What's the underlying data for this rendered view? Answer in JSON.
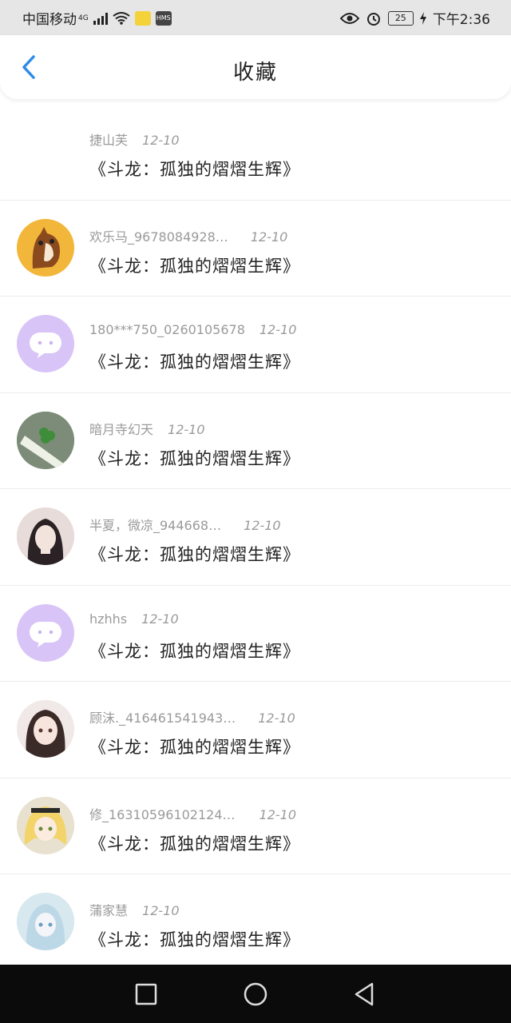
{
  "status_bar": {
    "carrier": "中国移动",
    "network": "4G",
    "battery": "25",
    "time": "下午2:36"
  },
  "header": {
    "title": "收藏"
  },
  "items": [
    {
      "name": "捷山芙",
      "date": "12-10",
      "content": "《斗龙：孤独的熠熠生辉》",
      "avatar": "none"
    },
    {
      "name": "欢乐马_9678084928…",
      "date": "12-10",
      "content": "《斗龙：孤独的熠熠生辉》",
      "avatar": "horse"
    },
    {
      "name": "180***750_0260105678",
      "date": "12-10",
      "content": "《斗龙：孤独的熠熠生辉》",
      "avatar": "default-chat"
    },
    {
      "name": "暗月寺幻天",
      "date": "12-10",
      "content": "《斗龙：孤独的熠熠生辉》",
      "avatar": "clover"
    },
    {
      "name": "半夏，微凉_944668…",
      "date": "12-10",
      "content": "《斗龙：孤独的熠熠生辉》",
      "avatar": "girl-dark"
    },
    {
      "name": "hzhhs",
      "date": "12-10",
      "content": "《斗龙：孤独的熠熠生辉》",
      "avatar": "default-chat"
    },
    {
      "name": "顾沫._416461541943…",
      "date": "12-10",
      "content": "《斗龙：孤独的熠熠生辉》",
      "avatar": "girl-anime"
    },
    {
      "name": "修_16310596102124…",
      "date": "12-10",
      "content": "《斗龙：孤独的熠熠生辉》",
      "avatar": "anime-blonde"
    },
    {
      "name": "蒲家慧",
      "date": "12-10",
      "content": "《斗龙：孤独的熠熠生辉》",
      "avatar": "anime-pastel"
    }
  ],
  "colors": {
    "accent": "#2f8be8",
    "default_avatar": "#d8c4f7"
  }
}
